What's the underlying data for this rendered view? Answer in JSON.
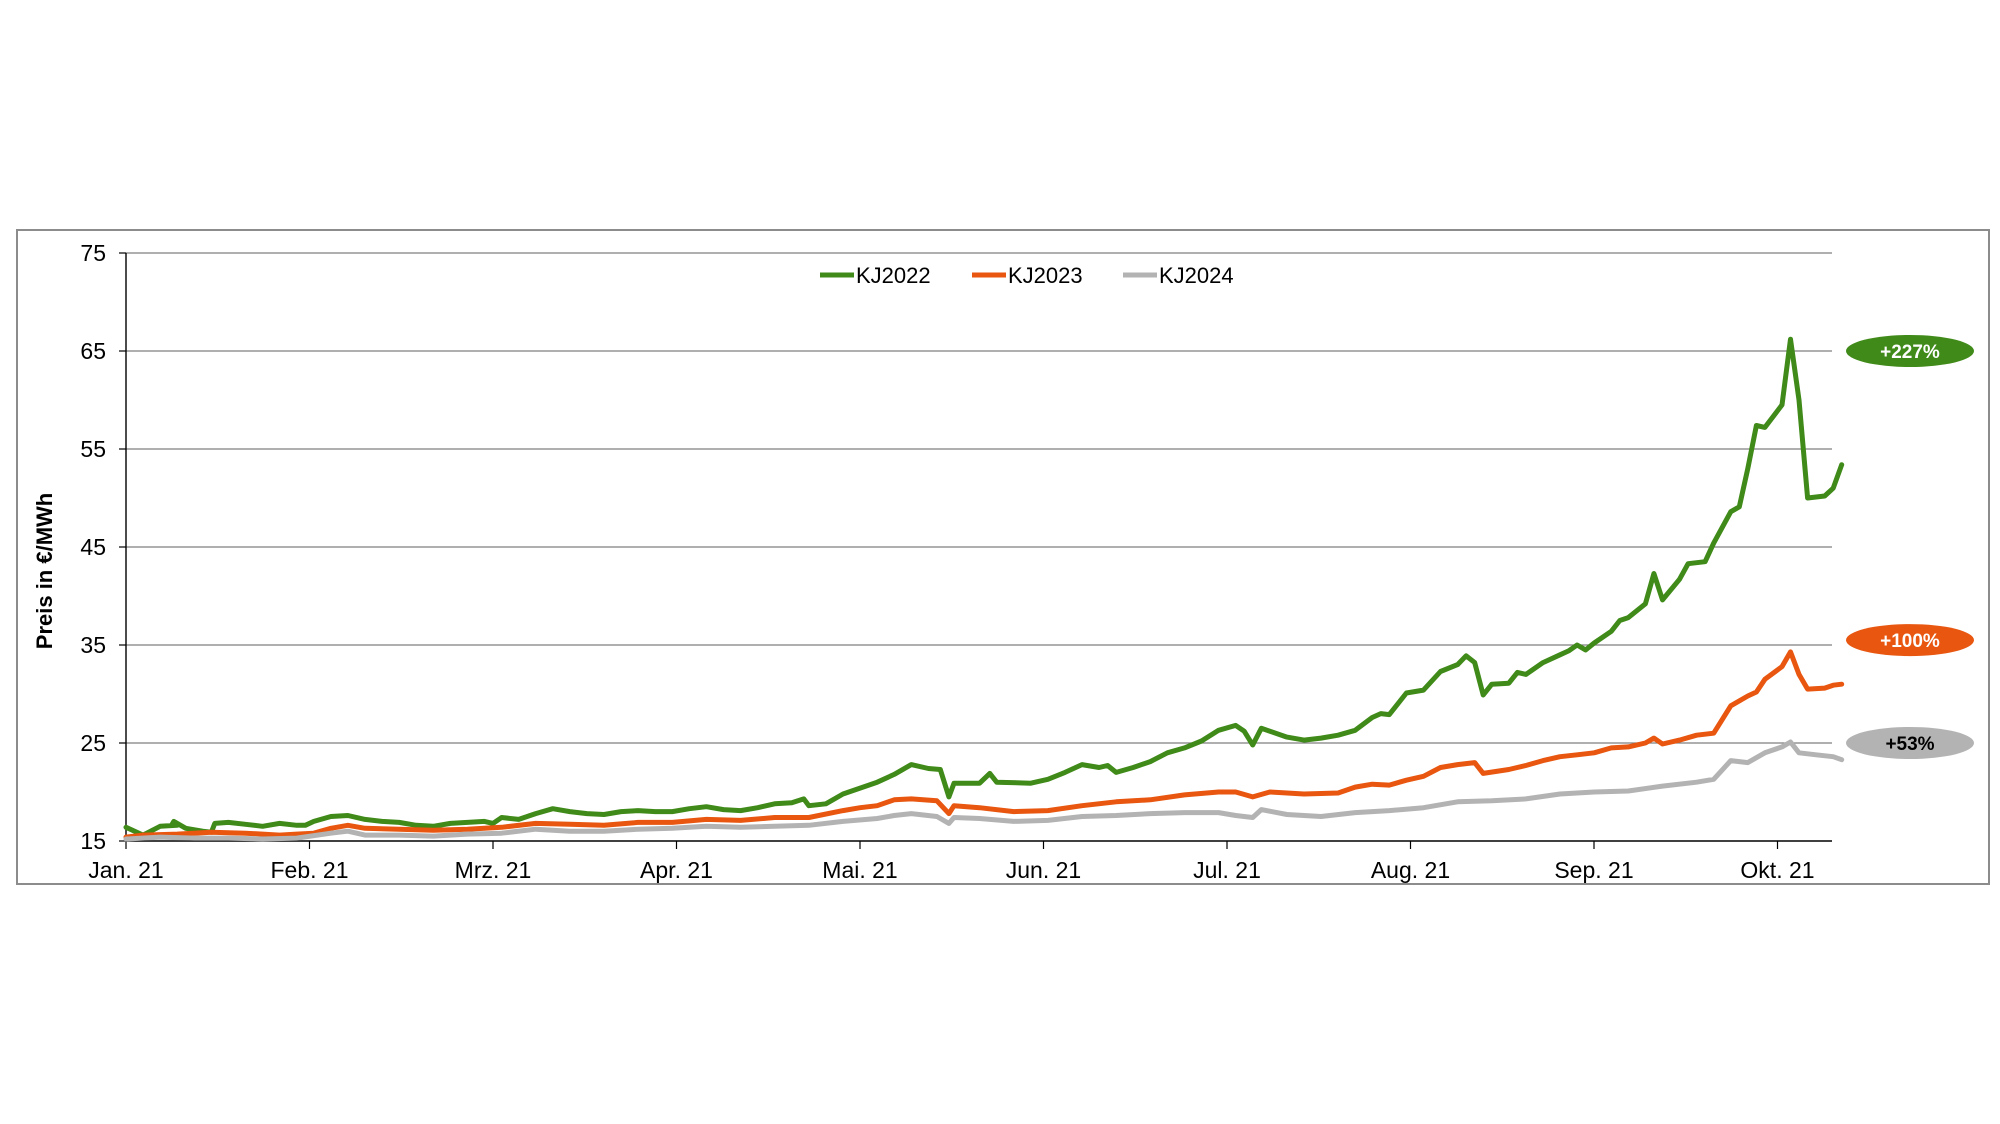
{
  "chart_data": {
    "type": "line",
    "title": "",
    "xlabel": "",
    "ylabel": "Preis in €/MWh",
    "ylim": [
      15,
      75
    ],
    "yticks": [
      "75",
      "65",
      "55",
      "45",
      "35",
      "25",
      "15"
    ],
    "xlim": [
      0,
      9.35
    ],
    "xticks": [
      "Jan. 21",
      "Feb. 21",
      "Mrz. 21",
      "Apr. 21",
      "Mai. 21",
      "Jun. 21",
      "Jul. 21",
      "Aug. 21",
      "Sep. 21",
      "Okt. 21"
    ],
    "grid": "horizontal",
    "legend": "top-center",
    "series": [
      {
        "name": "KJ2022",
        "color": "#3f8a18",
        "points": [
          [
            0,
            16.4
          ],
          [
            0.1,
            15.6
          ],
          [
            0.2,
            16.5
          ],
          [
            0.3,
            16.6
          ],
          [
            0.27,
            16.7
          ],
          [
            0.28,
            17.0
          ],
          [
            0.35,
            16.3
          ],
          [
            0.45,
            16.0
          ],
          [
            0.5,
            15.9
          ],
          [
            0.52,
            16.8
          ],
          [
            0.6,
            16.9
          ],
          [
            0.7,
            16.7
          ],
          [
            0.8,
            16.5
          ],
          [
            0.9,
            16.8
          ],
          [
            1.0,
            16.6
          ],
          [
            1.05,
            16.6
          ],
          [
            1.1,
            17.0
          ],
          [
            1.2,
            17.5
          ],
          [
            1.3,
            17.6
          ],
          [
            1.4,
            17.2
          ],
          [
            1.5,
            17.0
          ],
          [
            1.6,
            16.9
          ],
          [
            1.7,
            16.6
          ],
          [
            1.8,
            16.5
          ],
          [
            1.9,
            16.8
          ],
          [
            2.0,
            16.9
          ],
          [
            2.1,
            17.0
          ],
          [
            2.15,
            16.8
          ],
          [
            2.2,
            17.4
          ],
          [
            2.3,
            17.2
          ],
          [
            2.4,
            17.8
          ],
          [
            2.5,
            18.3
          ],
          [
            2.6,
            18.0
          ],
          [
            2.7,
            17.8
          ],
          [
            2.8,
            17.7
          ],
          [
            2.9,
            18.0
          ],
          [
            3.0,
            18.1
          ],
          [
            3.1,
            18.0
          ],
          [
            3.2,
            18.0
          ],
          [
            3.3,
            18.3
          ],
          [
            3.4,
            18.5
          ],
          [
            3.5,
            18.2
          ],
          [
            3.6,
            18.1
          ],
          [
            3.7,
            18.4
          ],
          [
            3.8,
            18.8
          ],
          [
            3.9,
            18.9
          ],
          [
            3.97,
            19.3
          ],
          [
            4.0,
            18.6
          ],
          [
            4.1,
            18.8
          ],
          [
            4.2,
            19.8
          ],
          [
            4.3,
            20.4
          ],
          [
            4.4,
            21.0
          ],
          [
            4.5,
            21.8
          ],
          [
            4.6,
            22.8
          ],
          [
            4.7,
            22.4
          ],
          [
            4.77,
            22.3
          ],
          [
            4.82,
            19.5
          ],
          [
            4.85,
            20.9
          ],
          [
            5.0,
            20.9
          ],
          [
            5.06,
            21.9
          ],
          [
            5.1,
            21.0
          ],
          [
            5.3,
            20.9
          ],
          [
            5.4,
            21.3
          ],
          [
            5.5,
            22.0
          ],
          [
            5.6,
            22.8
          ],
          [
            5.7,
            22.5
          ],
          [
            5.75,
            22.7
          ],
          [
            5.8,
            22.0
          ],
          [
            5.9,
            22.5
          ],
          [
            6.0,
            23.1
          ],
          [
            6.1,
            24.0
          ],
          [
            6.2,
            24.5
          ],
          [
            6.3,
            25.2
          ],
          [
            6.4,
            26.3
          ],
          [
            6.5,
            26.8
          ],
          [
            6.55,
            26.2
          ],
          [
            6.6,
            24.8
          ],
          [
            6.65,
            26.5
          ],
          [
            6.8,
            25.6
          ],
          [
            6.9,
            25.3
          ],
          [
            7.0,
            25.5
          ],
          [
            7.1,
            25.8
          ],
          [
            7.2,
            26.3
          ],
          [
            7.3,
            27.6
          ],
          [
            7.35,
            28.0
          ],
          [
            7.4,
            27.9
          ],
          [
            7.5,
            30.1
          ],
          [
            7.6,
            30.4
          ],
          [
            7.7,
            32.3
          ],
          [
            7.8,
            33.0
          ],
          [
            7.85,
            33.9
          ],
          [
            7.9,
            33.2
          ],
          [
            7.95,
            29.9
          ],
          [
            8.0,
            31.0
          ],
          [
            8.1,
            31.1
          ],
          [
            8.15,
            32.2
          ],
          [
            8.2,
            32.0
          ],
          [
            8.3,
            33.2
          ],
          [
            8.4,
            34.0
          ],
          [
            8.45,
            34.4
          ],
          [
            8.5,
            35.0
          ],
          [
            8.55,
            34.5
          ],
          [
            8.6,
            35.2
          ],
          [
            8.7,
            36.4
          ],
          [
            8.75,
            37.5
          ],
          [
            8.8,
            37.8
          ],
          [
            8.9,
            39.2
          ],
          [
            8.95,
            42.3
          ],
          [
            9.0,
            39.6
          ],
          [
            9.1,
            41.7
          ],
          [
            9.15,
            43.3
          ],
          [
            9.25,
            43.5
          ],
          [
            9.3,
            45.4
          ],
          [
            9.4,
            48.6
          ],
          [
            9.45,
            49.1
          ],
          [
            9.5,
            53.0
          ],
          [
            9.55,
            57.4
          ],
          [
            9.6,
            57.2
          ],
          [
            9.7,
            59.5
          ],
          [
            9.75,
            66.2
          ],
          [
            9.8,
            60.0
          ],
          [
            9.85,
            50.0
          ],
          [
            9.95,
            50.2
          ],
          [
            10.0,
            51.0
          ],
          [
            10.05,
            53.4
          ]
        ]
      },
      {
        "name": "KJ2023",
        "color": "#e8560f",
        "points": [
          [
            0,
            15.4
          ],
          [
            0.1,
            15.6
          ],
          [
            0.3,
            15.7
          ],
          [
            0.5,
            15.9
          ],
          [
            0.7,
            15.8
          ],
          [
            0.9,
            15.6
          ],
          [
            1.0,
            15.7
          ],
          [
            1.1,
            15.8
          ],
          [
            1.2,
            16.3
          ],
          [
            1.3,
            16.6
          ],
          [
            1.4,
            16.3
          ],
          [
            1.6,
            16.2
          ],
          [
            1.8,
            16.1
          ],
          [
            2.0,
            16.2
          ],
          [
            2.2,
            16.4
          ],
          [
            2.4,
            16.8
          ],
          [
            2.6,
            16.7
          ],
          [
            2.8,
            16.6
          ],
          [
            3.0,
            16.9
          ],
          [
            3.2,
            16.9
          ],
          [
            3.4,
            17.2
          ],
          [
            3.6,
            17.1
          ],
          [
            3.8,
            17.4
          ],
          [
            4.0,
            17.4
          ],
          [
            4.2,
            18.1
          ],
          [
            4.3,
            18.4
          ],
          [
            4.4,
            18.6
          ],
          [
            4.5,
            19.2
          ],
          [
            4.6,
            19.3
          ],
          [
            4.75,
            19.1
          ],
          [
            4.82,
            17.8
          ],
          [
            4.85,
            18.6
          ],
          [
            5.0,
            18.4
          ],
          [
            5.2,
            18.0
          ],
          [
            5.4,
            18.1
          ],
          [
            5.6,
            18.6
          ],
          [
            5.8,
            19.0
          ],
          [
            6.0,
            19.2
          ],
          [
            6.2,
            19.7
          ],
          [
            6.4,
            20.0
          ],
          [
            6.5,
            20.0
          ],
          [
            6.6,
            19.5
          ],
          [
            6.7,
            20.0
          ],
          [
            6.9,
            19.8
          ],
          [
            7.1,
            19.9
          ],
          [
            7.2,
            20.5
          ],
          [
            7.3,
            20.8
          ],
          [
            7.4,
            20.7
          ],
          [
            7.5,
            21.2
          ],
          [
            7.6,
            21.6
          ],
          [
            7.7,
            22.5
          ],
          [
            7.8,
            22.8
          ],
          [
            7.9,
            23.0
          ],
          [
            7.95,
            21.9
          ],
          [
            8.1,
            22.3
          ],
          [
            8.2,
            22.7
          ],
          [
            8.3,
            23.2
          ],
          [
            8.4,
            23.6
          ],
          [
            8.5,
            23.8
          ],
          [
            8.6,
            24.0
          ],
          [
            8.7,
            24.5
          ],
          [
            8.8,
            24.6
          ],
          [
            8.9,
            25.0
          ],
          [
            8.95,
            25.5
          ],
          [
            9.0,
            24.9
          ],
          [
            9.1,
            25.3
          ],
          [
            9.2,
            25.8
          ],
          [
            9.3,
            26.0
          ],
          [
            9.4,
            28.8
          ],
          [
            9.5,
            29.8
          ],
          [
            9.55,
            30.2
          ],
          [
            9.6,
            31.5
          ],
          [
            9.7,
            32.8
          ],
          [
            9.75,
            34.3
          ],
          [
            9.8,
            32.0
          ],
          [
            9.85,
            30.5
          ],
          [
            9.95,
            30.6
          ],
          [
            10.0,
            30.9
          ],
          [
            10.05,
            31.0
          ]
        ]
      },
      {
        "name": "KJ2024",
        "color": "#b3b3b3",
        "points": [
          [
            0,
            15.2
          ],
          [
            0.2,
            15.4
          ],
          [
            0.4,
            15.3
          ],
          [
            0.6,
            15.3
          ],
          [
            0.8,
            15.2
          ],
          [
            1.0,
            15.3
          ],
          [
            1.2,
            15.8
          ],
          [
            1.3,
            16.0
          ],
          [
            1.4,
            15.6
          ],
          [
            1.6,
            15.6
          ],
          [
            1.8,
            15.5
          ],
          [
            2.0,
            15.7
          ],
          [
            2.2,
            15.8
          ],
          [
            2.4,
            16.2
          ],
          [
            2.6,
            16.0
          ],
          [
            2.8,
            16.0
          ],
          [
            3.0,
            16.2
          ],
          [
            3.2,
            16.3
          ],
          [
            3.4,
            16.5
          ],
          [
            3.6,
            16.4
          ],
          [
            3.8,
            16.5
          ],
          [
            4.0,
            16.6
          ],
          [
            4.2,
            17.0
          ],
          [
            4.4,
            17.3
          ],
          [
            4.5,
            17.6
          ],
          [
            4.6,
            17.8
          ],
          [
            4.75,
            17.5
          ],
          [
            4.82,
            16.8
          ],
          [
            4.85,
            17.4
          ],
          [
            5.0,
            17.3
          ],
          [
            5.2,
            17.0
          ],
          [
            5.4,
            17.1
          ],
          [
            5.6,
            17.5
          ],
          [
            5.8,
            17.6
          ],
          [
            6.0,
            17.8
          ],
          [
            6.2,
            17.9
          ],
          [
            6.4,
            17.9
          ],
          [
            6.5,
            17.6
          ],
          [
            6.6,
            17.4
          ],
          [
            6.65,
            18.2
          ],
          [
            6.8,
            17.7
          ],
          [
            7.0,
            17.5
          ],
          [
            7.2,
            17.9
          ],
          [
            7.4,
            18.1
          ],
          [
            7.6,
            18.4
          ],
          [
            7.8,
            19.0
          ],
          [
            8.0,
            19.1
          ],
          [
            8.2,
            19.3
          ],
          [
            8.4,
            19.8
          ],
          [
            8.6,
            20.0
          ],
          [
            8.8,
            20.1
          ],
          [
            9.0,
            20.6
          ],
          [
            9.2,
            21.0
          ],
          [
            9.3,
            21.3
          ],
          [
            9.4,
            23.2
          ],
          [
            9.5,
            23.0
          ],
          [
            9.6,
            24.0
          ],
          [
            9.7,
            24.6
          ],
          [
            9.75,
            25.1
          ],
          [
            9.8,
            24.0
          ],
          [
            9.9,
            23.8
          ],
          [
            10.0,
            23.6
          ],
          [
            10.05,
            23.3
          ]
        ]
      }
    ],
    "annotations": [
      {
        "text": "+227%",
        "series": "KJ2022",
        "y": 65,
        "color": "#3f8a18",
        "text_color": "#ffffff"
      },
      {
        "text": "+100%",
        "series": "KJ2023",
        "y": 35.5,
        "color": "#e8560f",
        "text_color": "#ffffff"
      },
      {
        "text": "+53%",
        "series": "KJ2024",
        "y": 25,
        "color": "#b3b3b3",
        "text_color": "#000000"
      }
    ]
  }
}
